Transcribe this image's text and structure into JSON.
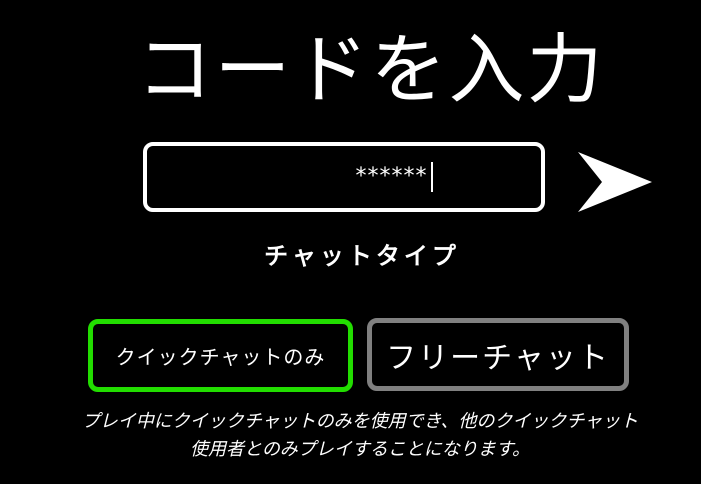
{
  "title": "コードを入力",
  "code_input": {
    "value": "******"
  },
  "chat_type": {
    "label": "チャットタイプ",
    "options": [
      {
        "label": "クイックチャットのみ",
        "selected": true
      },
      {
        "label": "フリーチャット",
        "selected": false
      }
    ]
  },
  "description": {
    "line1": "プレイ中にクイックチャットのみを使用でき、他のクイックチャット",
    "line2": "使用者とのみプレイすることになります。"
  },
  "icons": {
    "submit": "arrow-right-icon"
  },
  "colors": {
    "background": "#000000",
    "selected_border": "#22dd00",
    "unselected_border": "#808080",
    "text": "#ffffff"
  }
}
